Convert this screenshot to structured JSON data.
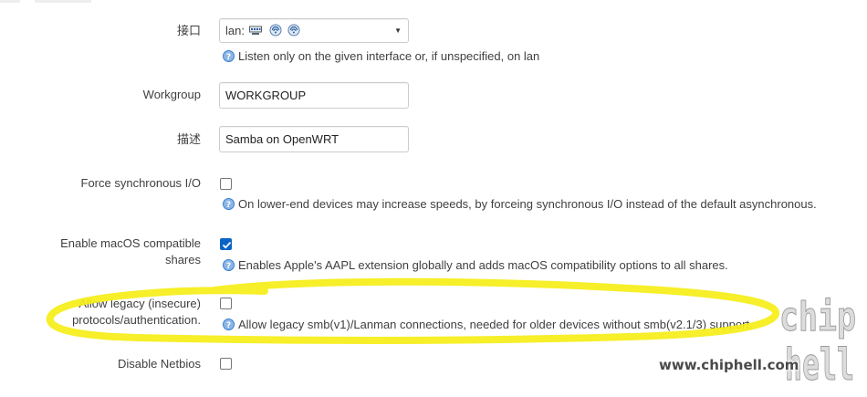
{
  "form": {
    "interface": {
      "label": "接口",
      "selected": "lan:",
      "help": "Listen only on the given interface or, if unspecified, on lan"
    },
    "workgroup": {
      "label": "Workgroup",
      "value": "WORKGROUP"
    },
    "description": {
      "label": "描述",
      "value": "Samba on OpenWRT"
    },
    "force_sync": {
      "label": "Force synchronous I/O",
      "checked": false,
      "help": "On lower-end devices may increase speeds, by forceing synchronous I/O instead of the default asynchronous."
    },
    "macos": {
      "label_line1": "Enable macOS compatible",
      "label_line2": "shares",
      "checked": true,
      "help": "Enables Apple's AAPL extension globally and adds macOS compatibility options to all shares."
    },
    "legacy": {
      "label_line1": "Allow legacy (insecure)",
      "label_line2": "protocols/authentication.",
      "checked": false,
      "help": "Allow legacy smb(v1)/Lanman connections, needed for older devices without smb(v2.1/3) support."
    },
    "netbios": {
      "label": "Disable Netbios",
      "checked": false
    }
  },
  "watermark": {
    "site": "www.chiphell.com",
    "logo_top": "chip",
    "logo_bottom": "hell"
  },
  "colors": {
    "highlight": "#f5ee17",
    "checkbox_checked": "#0b64c5",
    "help_icon": "#3b7fd0"
  },
  "icons": {
    "help": "help-circle-icon",
    "interface": [
      "ethernet-switch-icon",
      "wifi-icon",
      "wifi-icon"
    ],
    "dropdown": "caret-down-icon"
  }
}
